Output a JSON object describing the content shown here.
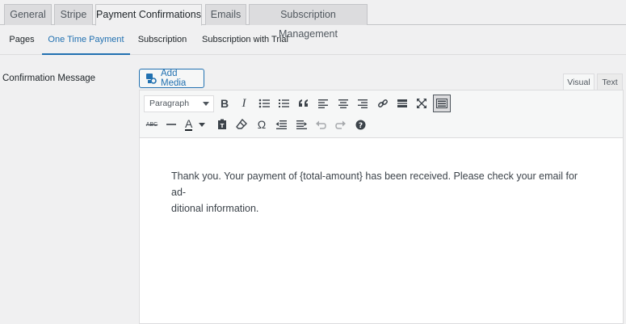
{
  "tabs": [
    {
      "label": "General"
    },
    {
      "label": "Stripe"
    },
    {
      "label": "Payment Confirmations"
    },
    {
      "label": "Emails"
    },
    {
      "label": "Subscription Management"
    }
  ],
  "subtabs": [
    {
      "label": "Pages"
    },
    {
      "label": "One Time Payment"
    },
    {
      "label": "Subscription"
    },
    {
      "label": "Subscription with Trial"
    }
  ],
  "field": {
    "label": "Confirmation Message",
    "add_media": "Add Media",
    "mode_visual": "Visual",
    "mode_text": "Text"
  },
  "toolbar": {
    "format_value": "Paragraph",
    "row1": [
      "bold-icon",
      "italic-icon",
      "bullet-list-icon",
      "numbered-list-icon",
      "blockquote-icon",
      "align-left-icon",
      "align-center-icon",
      "align-right-icon",
      "link-icon",
      "read-more-icon",
      "fullscreen-icon",
      "toolbar-toggle-icon"
    ],
    "row2": [
      "strikethrough-icon",
      "horizontal-line-icon",
      "text-color-icon",
      "paste-text-icon",
      "clear-format-icon",
      "special-char-icon",
      "outdent-icon",
      "indent-icon",
      "undo-icon",
      "redo-icon",
      "help-icon"
    ],
    "strike_glyph": "ABC",
    "omega_glyph": "Ω",
    "bold_glyph": "B",
    "italic_glyph": "I",
    "color_glyph": "A"
  },
  "editor": {
    "content_line1": "Thank you. Your payment of {total-amount} has been received. Please check your email for ad-",
    "content_line2": "ditional information."
  },
  "colors": {
    "accent": "#2271b1",
    "border": "#c3c4c7",
    "background": "#f0f0f1"
  }
}
